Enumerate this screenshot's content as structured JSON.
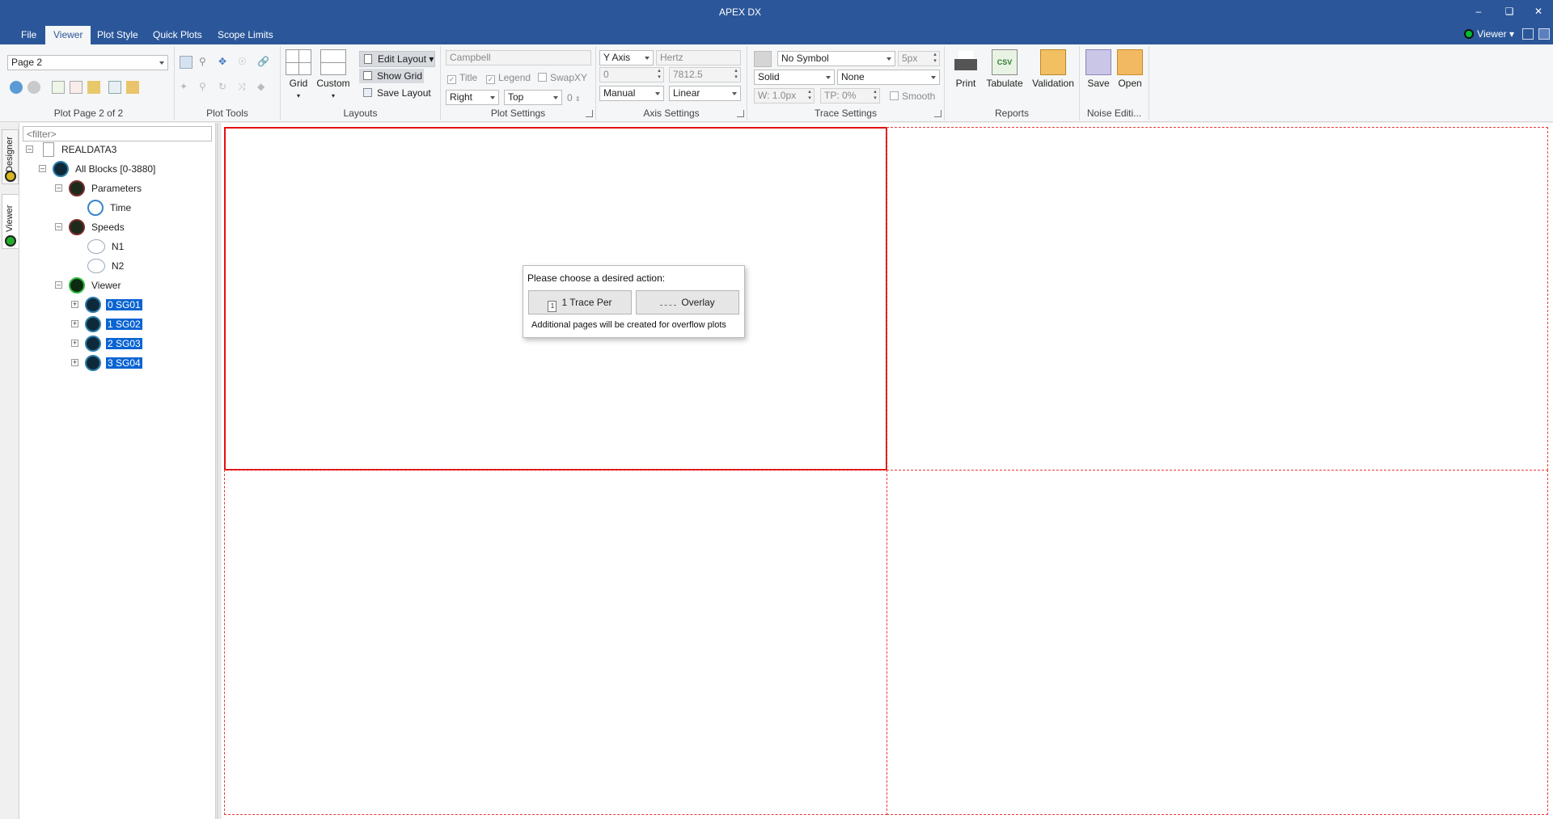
{
  "window": {
    "title": "APEX DX"
  },
  "menu": {
    "tabs": [
      "File",
      "Viewer",
      "Plot Style",
      "Quick Plots",
      "Scope Limits"
    ],
    "right_label": "Viewer"
  },
  "ribbon": {
    "page_select": "Page 2",
    "page_group_label": "Plot Page 2 of 2",
    "plot_tools_label": "Plot Tools",
    "layouts": {
      "grid": "Grid",
      "custom": "Custom",
      "edit_layout": "Edit Layout",
      "show_grid": "Show Grid",
      "save_layout": "Save Layout",
      "label": "Layouts"
    },
    "plot_settings": {
      "title_field": "Campbell",
      "title_check": "Title",
      "legend_check": "Legend",
      "swapxy_check": "SwapXY",
      "legend_pos_h": "Right",
      "legend_pos_v": "Top",
      "legend_offset": "0",
      "label": "Plot Settings"
    },
    "axis_settings": {
      "axis": "Y Axis",
      "unit": "Hertz",
      "min": "0",
      "max": "7812.5",
      "mode": "Manual",
      "scale": "Linear",
      "label": "Axis Settings"
    },
    "trace_settings": {
      "symbol": "No Symbol",
      "symbol_size": "5px",
      "line_style": "Solid",
      "fill": "None",
      "width": "W: 1.0px",
      "tp": "TP: 0%",
      "smooth": "Smooth",
      "label": "Trace Settings"
    },
    "reports": {
      "print": "Print",
      "tabulate": "Tabulate",
      "validation": "Validation",
      "label": "Reports"
    },
    "noise": {
      "save": "Save",
      "open": "Open",
      "label": "Noise Editi..."
    }
  },
  "sidetabs": [
    "Designer",
    "Viewer"
  ],
  "tree": {
    "filter_placeholder": "<filter>",
    "nodes": [
      {
        "label": "REALDATA3"
      },
      {
        "label": "All Blocks [0-3880]"
      },
      {
        "label": "Parameters"
      },
      {
        "label": "Time"
      },
      {
        "label": "Speeds"
      },
      {
        "label": "N1"
      },
      {
        "label": "N2"
      },
      {
        "label": "Viewer"
      },
      {
        "label": "0 SG01"
      },
      {
        "label": "1 SG02"
      },
      {
        "label": "2 SG03"
      },
      {
        "label": "3 SG04"
      }
    ]
  },
  "dialog": {
    "prompt": "Please choose a desired action:",
    "btn_one": "1 Trace Per",
    "btn_two": "Overlay",
    "note": "Additional pages will be created for overflow plots"
  },
  "colors": {
    "titlebar": "#2b579a",
    "selection": "#0a64d2",
    "layout_border": "#e41010"
  }
}
